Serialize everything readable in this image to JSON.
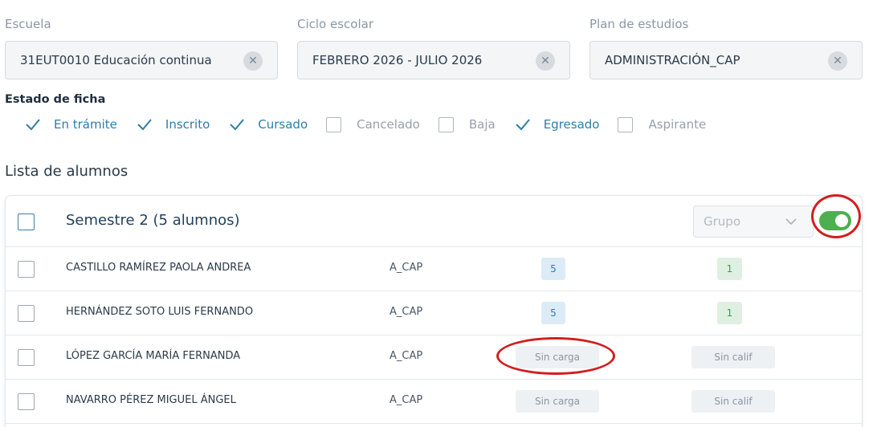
{
  "filters": {
    "escuela": {
      "label": "Escuela",
      "value": "31EUT0010 Educación continua"
    },
    "ciclo": {
      "label": "Ciclo escolar",
      "value": "FEBRERO 2026 - JULIO 2026"
    },
    "plan": {
      "label": "Plan de estudios",
      "value": "ADMINISTRACIÓN_CAP"
    },
    "clear_glyph": "✕"
  },
  "estado": {
    "title": "Estado de ficha",
    "items": [
      {
        "label": "En trámite",
        "checked": true
      },
      {
        "label": "Inscrito",
        "checked": true
      },
      {
        "label": "Cursado",
        "checked": true
      },
      {
        "label": "Cancelado",
        "checked": false
      },
      {
        "label": "Baja",
        "checked": false
      },
      {
        "label": "Egresado",
        "checked": true
      },
      {
        "label": "Aspirante",
        "checked": false
      }
    ]
  },
  "lista": {
    "title": "Lista de alumnos",
    "group_title": "Semestre 2 (5 alumnos)",
    "grupo_placeholder": "Grupo",
    "toggle_on": true
  },
  "students": [
    {
      "name": "CASTILLO RAMÍREZ PAOLA ANDREA",
      "plan": "A_CAP",
      "carga": "5",
      "calif": "1"
    },
    {
      "name": "HERNÁNDEZ SOTO LUIS FERNANDO",
      "plan": "A_CAP",
      "carga": "5",
      "calif": "1"
    },
    {
      "name": "LÓPEZ GARCÍA MARÍA FERNANDA",
      "plan": "A_CAP",
      "carga": "Sin carga",
      "calif": "Sin calif"
    },
    {
      "name": "NAVARRO PÉREZ MIGUEL ÁNGEL",
      "plan": "A_CAP",
      "carga": "Sin carga",
      "calif": "Sin calif"
    }
  ],
  "colors": {
    "accent_blue": "#2d7ea8",
    "toggle_green": "#4caf50",
    "annotation_red": "#d21e1e"
  }
}
